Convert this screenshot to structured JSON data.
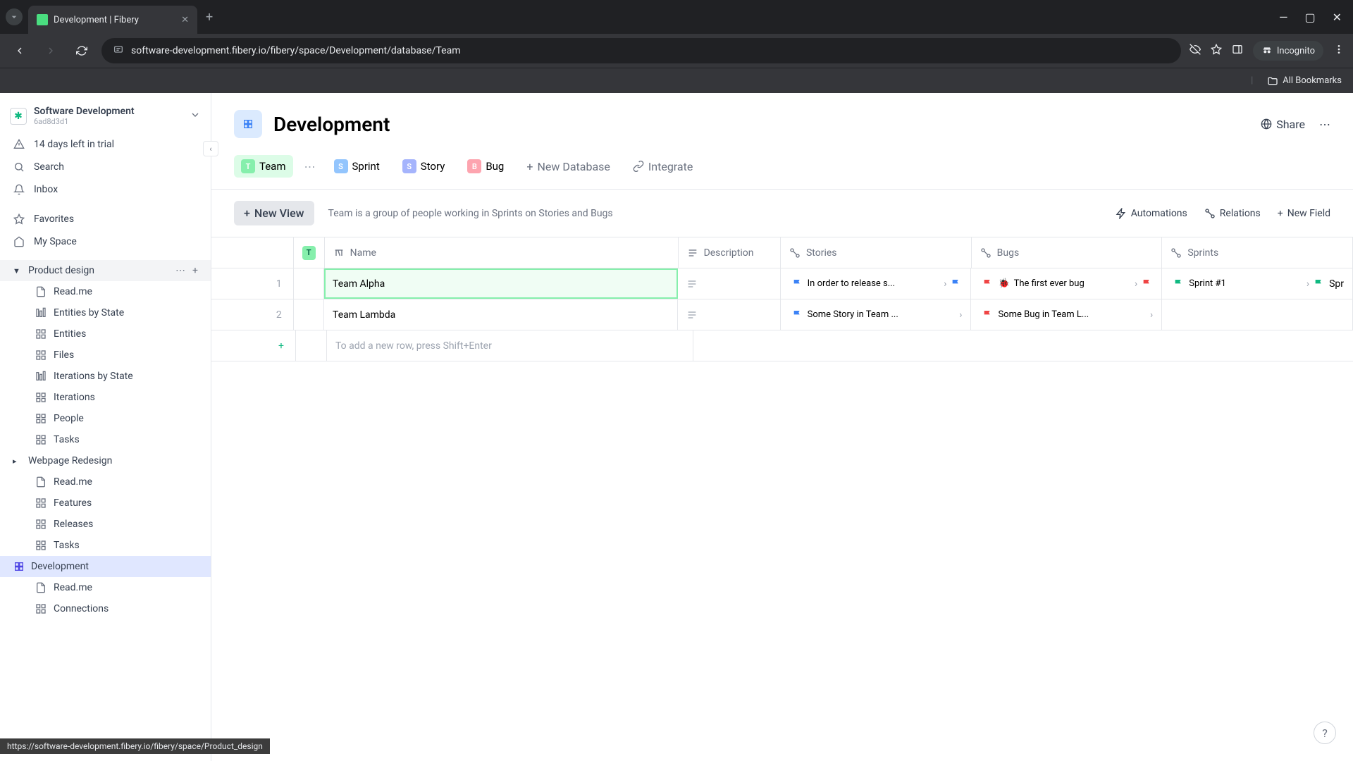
{
  "browser": {
    "tab_title": "Development | Fibery",
    "url": "software-development.fibery.io/fibery/space/Development/database/Team",
    "incognito_label": "Incognito",
    "all_bookmarks": "All Bookmarks"
  },
  "workspace": {
    "name": "Software Development",
    "id": "6ad8d3d1"
  },
  "sidebar": {
    "trial": "14 days left in trial",
    "search": "Search",
    "inbox": "Inbox",
    "favorites": "Favorites",
    "my_space": "My Space",
    "spaces": [
      {
        "name": "Product design",
        "expanded": true,
        "hovered": true,
        "children": [
          "Read.me",
          "Entities by State",
          "Entities",
          "Files",
          "Iterations by State",
          "Iterations",
          "People",
          "Tasks"
        ]
      },
      {
        "name": "Webpage Redesign",
        "expanded": false,
        "children": [
          "Read.me",
          "Features",
          "Releases",
          "Tasks"
        ]
      },
      {
        "name": "Development",
        "expanded": false,
        "active": true,
        "children": [
          "Read.me",
          "Connections"
        ]
      }
    ]
  },
  "page": {
    "title": "Development",
    "share": "Share"
  },
  "db_tabs": [
    {
      "label": "Team",
      "badge": "T",
      "color": "#86efac",
      "active": true
    },
    {
      "label": "Sprint",
      "badge": "S",
      "color": "#93c5fd"
    },
    {
      "label": "Story",
      "badge": "S",
      "color": "#a5b4fc"
    },
    {
      "label": "Bug",
      "badge": "B",
      "color": "#fda4af"
    }
  ],
  "db_actions": {
    "new_db": "New Database",
    "integrate": "Integrate"
  },
  "view": {
    "new_view": "New View",
    "description": "Team is a group of people working in Sprints on Stories and Bugs",
    "automations": "Automations",
    "relations": "Relations",
    "new_field": "New Field"
  },
  "columns": [
    "Name",
    "Description",
    "Stories",
    "Bugs",
    "Sprints"
  ],
  "rows": [
    {
      "num": "1",
      "name": "Team Alpha",
      "selected": true,
      "stories": [
        {
          "text": "In order to release s...",
          "color": "blue"
        }
      ],
      "stories_more": true,
      "bugs": [
        {
          "text": "The first ever bug",
          "color": "red",
          "emoji": "🐞"
        }
      ],
      "bugs_more": true,
      "sprints": [
        {
          "text": "Sprint #1",
          "color": "green"
        }
      ],
      "sprints_more": "Spr"
    },
    {
      "num": "2",
      "name": "Team Lambda",
      "stories": [
        {
          "text": "Some Story in Team ...",
          "color": "blue"
        }
      ],
      "bugs": [
        {
          "text": "Some Bug in Team L...",
          "color": "red"
        }
      ],
      "sprints": []
    }
  ],
  "add_row_hint": "To add a new row, press Shift+Enter",
  "status_url": "https://software-development.fibery.io/fibery/space/Product_design"
}
